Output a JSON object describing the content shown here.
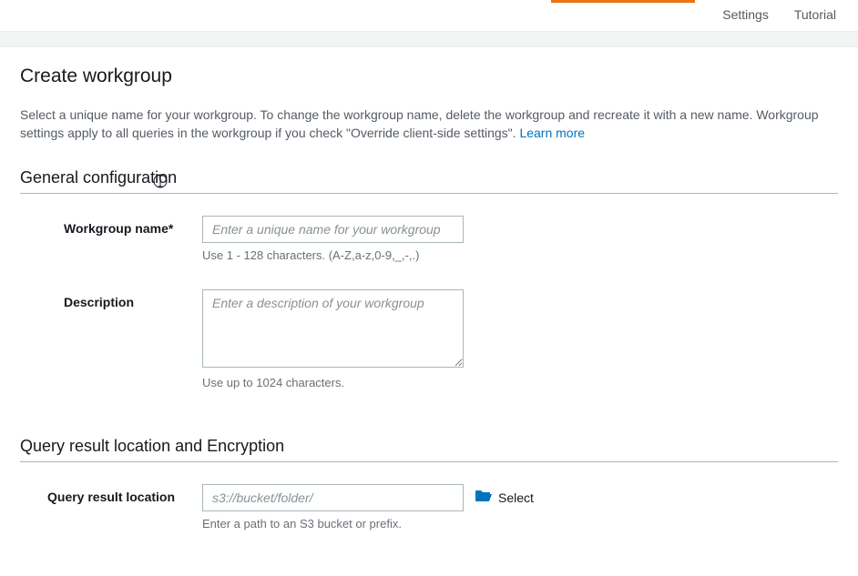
{
  "topbar": {
    "settings": "Settings",
    "tutorial": "Tutorial"
  },
  "page": {
    "title": "Create workgroup",
    "intro_before": "Select a unique name for your workgroup. To change the workgroup name, delete the workgroup and recreate it with a new name. Workgroup settings apply to all queries in the workgroup if you check \"Override client-side settings\". ",
    "learn_more": "Learn more"
  },
  "sections": {
    "general": {
      "title": "General configuration",
      "name": {
        "label": "Workgroup name*",
        "placeholder": "Enter a unique name for your workgroup",
        "hint": "Use 1 - 128 characters. (A-Z,a-z,0-9,_,-,.)",
        "value": ""
      },
      "description": {
        "label": "Description",
        "placeholder": "Enter a description of your workgroup",
        "hint": "Use up to 1024 characters.",
        "value": ""
      }
    },
    "query": {
      "title": "Query result location and Encryption",
      "location": {
        "label": "Query result location",
        "placeholder": "s3://bucket/folder/",
        "hint": "Enter a path to an S3 bucket or prefix.",
        "value": "",
        "select_label": "Select"
      }
    }
  }
}
